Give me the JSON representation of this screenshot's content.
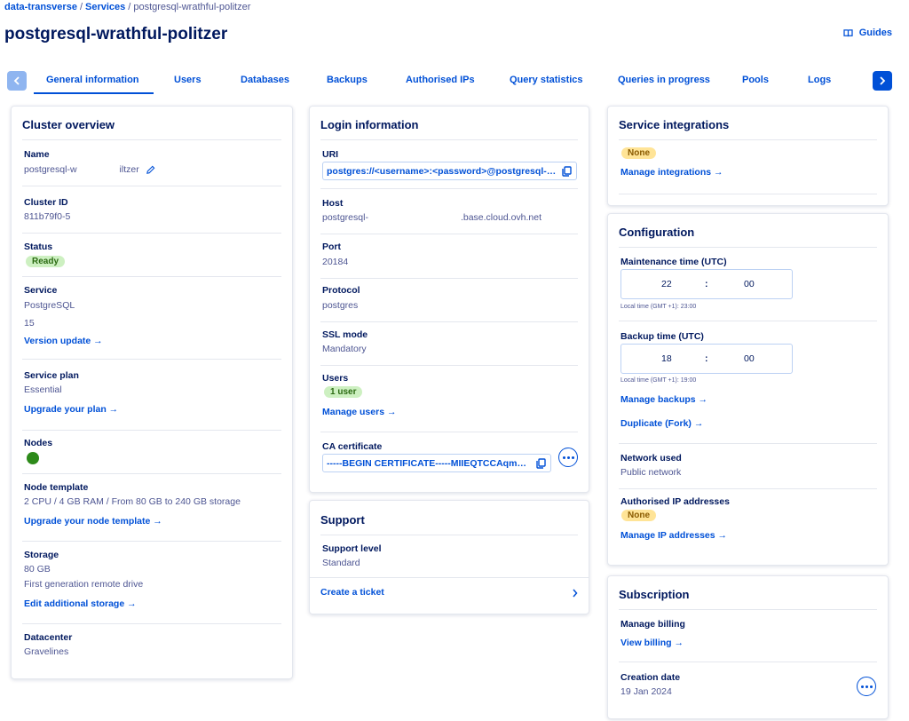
{
  "breadcrumb": {
    "items": [
      "data-transverse",
      "Services",
      "postgresql-wrathful-politzer"
    ]
  },
  "page": {
    "title": "postgresql-wrathful-politzer",
    "guides_label": "Guides"
  },
  "tabs": [
    {
      "label": "General information",
      "active": true
    },
    {
      "label": "Users"
    },
    {
      "label": "Databases"
    },
    {
      "label": "Backups"
    },
    {
      "label": "Authorised IPs"
    },
    {
      "label": "Query statistics"
    },
    {
      "label": "Queries in progress"
    },
    {
      "label": "Pools"
    },
    {
      "label": "Logs"
    }
  ],
  "cluster": {
    "title": "Cluster overview",
    "name_label": "Name",
    "name_value_start": "postgresql-w",
    "name_value_end": "iltzer",
    "id_label": "Cluster ID",
    "id_value": "811b79f0-5",
    "status_label": "Status",
    "status_value": "Ready",
    "service_label": "Service",
    "service_value": "PostgreSQL",
    "service_version": "15",
    "version_update": "Version update →",
    "plan_label": "Service plan",
    "plan_value": "Essential",
    "upgrade_plan": "Upgrade your plan →",
    "nodes_label": "Nodes",
    "node_template_label": "Node template",
    "node_template_value": "2 CPU / 4 GB RAM / From 80 GB to 240 GB storage",
    "upgrade_node": "Upgrade your node template →",
    "storage_label": "Storage",
    "storage_value": "80 GB",
    "storage_type": "First generation remote drive",
    "edit_storage": "Edit additional storage →",
    "datacenter_label": "Datacenter",
    "datacenter_value": "Gravelines"
  },
  "login": {
    "title": "Login information",
    "uri_label": "URI",
    "uri_value": "postgres://<username>:<password>@postgresql-811 ...",
    "host_label": "Host",
    "host_value_start": "postgresql-",
    "host_value_end": ".base.cloud.ovh.net",
    "port_label": "Port",
    "port_value": "20184",
    "protocol_label": "Protocol",
    "protocol_value": "postgres",
    "ssl_label": "SSL mode",
    "ssl_value": "Mandatory",
    "users_label": "Users",
    "users_badge": "1 user",
    "manage_users": "Manage users →",
    "ca_label": "CA certificate",
    "ca_value": "-----BEGIN CERTIFICATE-----MIIEQTCCAqmgAwI ..."
  },
  "support": {
    "title": "Support",
    "level_label": "Support level",
    "level_value": "Standard",
    "create_ticket": "Create a ticket"
  },
  "integrations": {
    "title": "Service integrations",
    "badge": "None",
    "manage": "Manage integrations →"
  },
  "configuration": {
    "title": "Configuration",
    "maintenance_label": "Maintenance time (UTC)",
    "maintenance_hour": "22",
    "maintenance_minute": "00",
    "maintenance_hint": "Local time (GMT +1): 23:00",
    "backup_label": "Backup time (UTC)",
    "backup_hour": "18",
    "backup_minute": "00",
    "backup_hint": "Local time (GMT +1): 19:00",
    "manage_backups": "Manage backups →",
    "duplicate": "Duplicate (Fork) →",
    "network_label": "Network used",
    "network_value": "Public network",
    "ip_label": "Authorised IP addresses",
    "ip_badge": "None",
    "manage_ip": "Manage IP addresses →",
    "time_separator": ":"
  },
  "subscription": {
    "title": "Subscription",
    "billing_label": "Manage billing",
    "view_billing": "View billing →",
    "creation_label": "Creation date",
    "creation_value": "19 Jan 2024"
  },
  "colors": {
    "accent": "#0050d7",
    "text": "#00185e",
    "muted": "#4d5592",
    "ready": "#cdf0c1",
    "none": "#ffe497"
  }
}
